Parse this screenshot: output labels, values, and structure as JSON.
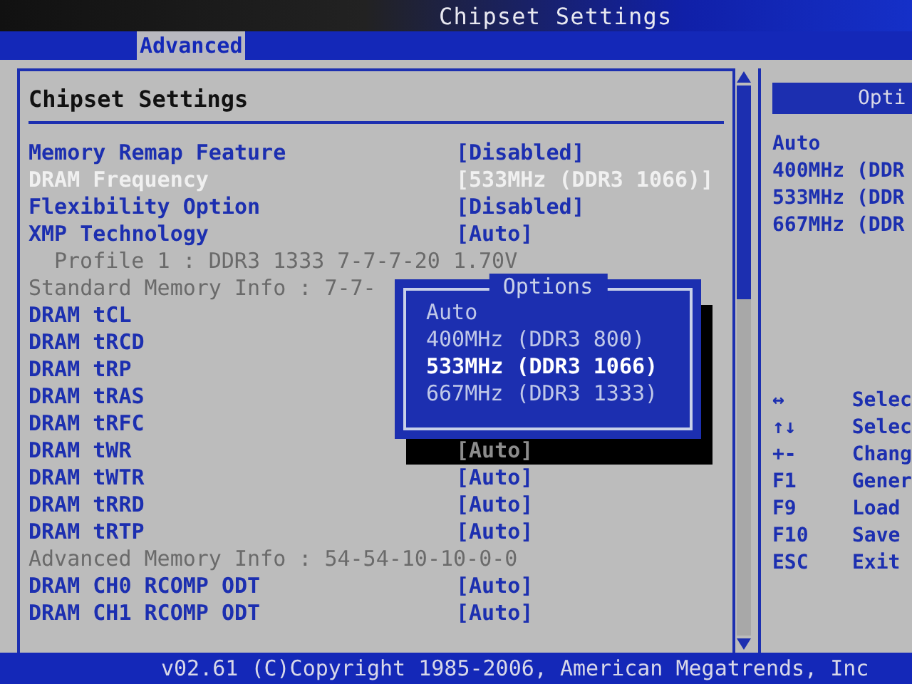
{
  "header": {
    "title": "Chipset Settings"
  },
  "tabs": [
    {
      "label": "Advanced",
      "selected": true
    }
  ],
  "panel": {
    "title": "Chipset Settings",
    "rows": [
      {
        "kind": "setting",
        "label": "Memory Remap Feature",
        "value": "[Disabled]",
        "selected": false
      },
      {
        "kind": "setting",
        "label": "DRAM Frequency",
        "value": "[533MHz (DDR3 1066)]",
        "selected": true
      },
      {
        "kind": "setting",
        "label": "Flexibility Option",
        "value": "[Disabled]",
        "selected": false
      },
      {
        "kind": "setting",
        "label": "XMP Technology",
        "value": "[Auto]",
        "selected": false
      },
      {
        "kind": "subinfo",
        "label": "Profile 1 : DDR3 1333 7-7-7-20 1.70V"
      },
      {
        "kind": "info",
        "label": "Standard Memory Info : 7-7-"
      },
      {
        "kind": "setting",
        "label": "DRAM tCL",
        "selected": false
      },
      {
        "kind": "setting",
        "label": "DRAM tRCD",
        "selected": false
      },
      {
        "kind": "setting",
        "label": "DRAM tRP",
        "selected": false
      },
      {
        "kind": "setting",
        "label": "DRAM tRAS",
        "selected": false
      },
      {
        "kind": "setting",
        "label": "DRAM tRFC",
        "selected": false
      },
      {
        "kind": "setting",
        "label": "DRAM tWR",
        "value": "[Auto]",
        "selected": false
      },
      {
        "kind": "setting",
        "label": "DRAM tWTR",
        "value": "[Auto]",
        "selected": false
      },
      {
        "kind": "setting",
        "label": "DRAM tRRD",
        "value": "[Auto]",
        "selected": false
      },
      {
        "kind": "setting",
        "label": "DRAM tRTP",
        "value": "[Auto]",
        "selected": false
      },
      {
        "kind": "info",
        "label": "Advanced Memory Info : 54-54-10-10-0-0"
      },
      {
        "kind": "setting",
        "label": "DRAM CH0 RCOMP ODT",
        "value": "[Auto]",
        "selected": false
      },
      {
        "kind": "setting",
        "label": "DRAM CH1 RCOMP ODT",
        "value": "[Auto]",
        "selected": false
      }
    ]
  },
  "popup": {
    "title": "Options",
    "options": [
      {
        "label": "Auto",
        "selected": false
      },
      {
        "label": "400MHz (DDR3 800)",
        "selected": false
      },
      {
        "label": "533MHz (DDR3 1066)",
        "selected": true
      },
      {
        "label": "667MHz (DDR3 1333)",
        "selected": false
      }
    ]
  },
  "help": {
    "title": "Opti",
    "options": [
      "Auto",
      "400MHz (DDR",
      "533MHz (DDR",
      "667MHz (DDR"
    ],
    "keys": [
      {
        "key": "↔",
        "action": "Selec"
      },
      {
        "key": "↑↓",
        "action": "Selec"
      },
      {
        "key": "+-",
        "action": "Chang"
      },
      {
        "key": "F1",
        "action": "Gener"
      },
      {
        "key": "F9",
        "action": "Load"
      },
      {
        "key": "F10",
        "action": "Save"
      },
      {
        "key": "ESC",
        "action": "Exit"
      }
    ]
  },
  "status_bar": {
    "text": "v02.61 (C)Copyright 1985-2006, American Megatrends, Inc"
  }
}
